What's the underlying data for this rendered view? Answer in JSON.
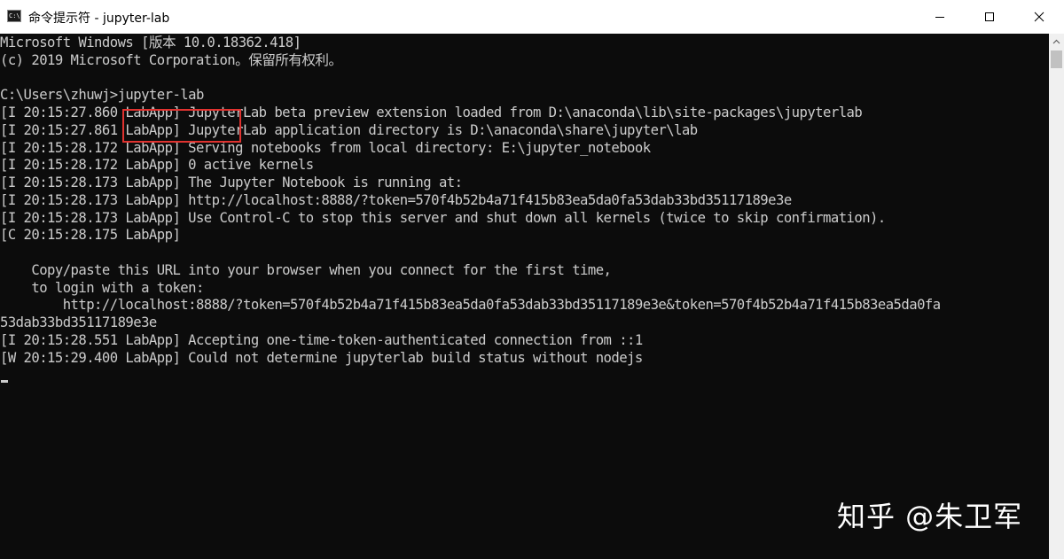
{
  "window": {
    "title": "命令提示符 - jupyter-lab",
    "icon": "cmd-icon",
    "icon_text": "C:\\"
  },
  "controls": {
    "minimize_icon": "minimize-icon",
    "maximize_icon": "maximize-icon",
    "close_icon": "close-icon"
  },
  "console": {
    "lines": [
      "Microsoft Windows [版本 10.0.18362.418]",
      "(c) 2019 Microsoft Corporation。保留所有权利。",
      "",
      "C:\\Users\\zhuwj>jupyter-lab",
      "[I 20:15:27.860 LabApp] JupyterLab beta preview extension loaded from D:\\anaconda\\lib\\site-packages\\jupyterlab",
      "[I 20:15:27.861 LabApp] JupyterLab application directory is D:\\anaconda\\share\\jupyter\\lab",
      "[I 20:15:28.172 LabApp] Serving notebooks from local directory: E:\\jupyter_notebook",
      "[I 20:15:28.172 LabApp] 0 active kernels",
      "[I 20:15:28.173 LabApp] The Jupyter Notebook is running at:",
      "[I 20:15:28.173 LabApp] http://localhost:8888/?token=570f4b52b4a71f415b83ea5da0fa53dab33bd35117189e3e",
      "[I 20:15:28.173 LabApp] Use Control-C to stop this server and shut down all kernels (twice to skip confirmation).",
      "[C 20:15:28.175 LabApp]",
      "",
      "    Copy/paste this URL into your browser when you connect for the first time,",
      "    to login with a token:",
      "        http://localhost:8888/?token=570f4b52b4a71f415b83ea5da0fa53dab33bd35117189e3e&token=570f4b52b4a71f415b83ea5da0fa",
      "53dab33bd35117189e3e",
      "[I 20:15:28.551 LabApp] Accepting one-time-token-authenticated connection from ::1",
      "[W 20:15:29.400 LabApp] Could not determine jupyterlab build status without nodejs"
    ]
  },
  "watermark": "知乎 @朱卫军",
  "colors": {
    "console_bg": "#0c0c0c",
    "console_text": "#cccccc",
    "highlight_box": "#e0322f",
    "titlebar_bg": "#ffffff"
  }
}
